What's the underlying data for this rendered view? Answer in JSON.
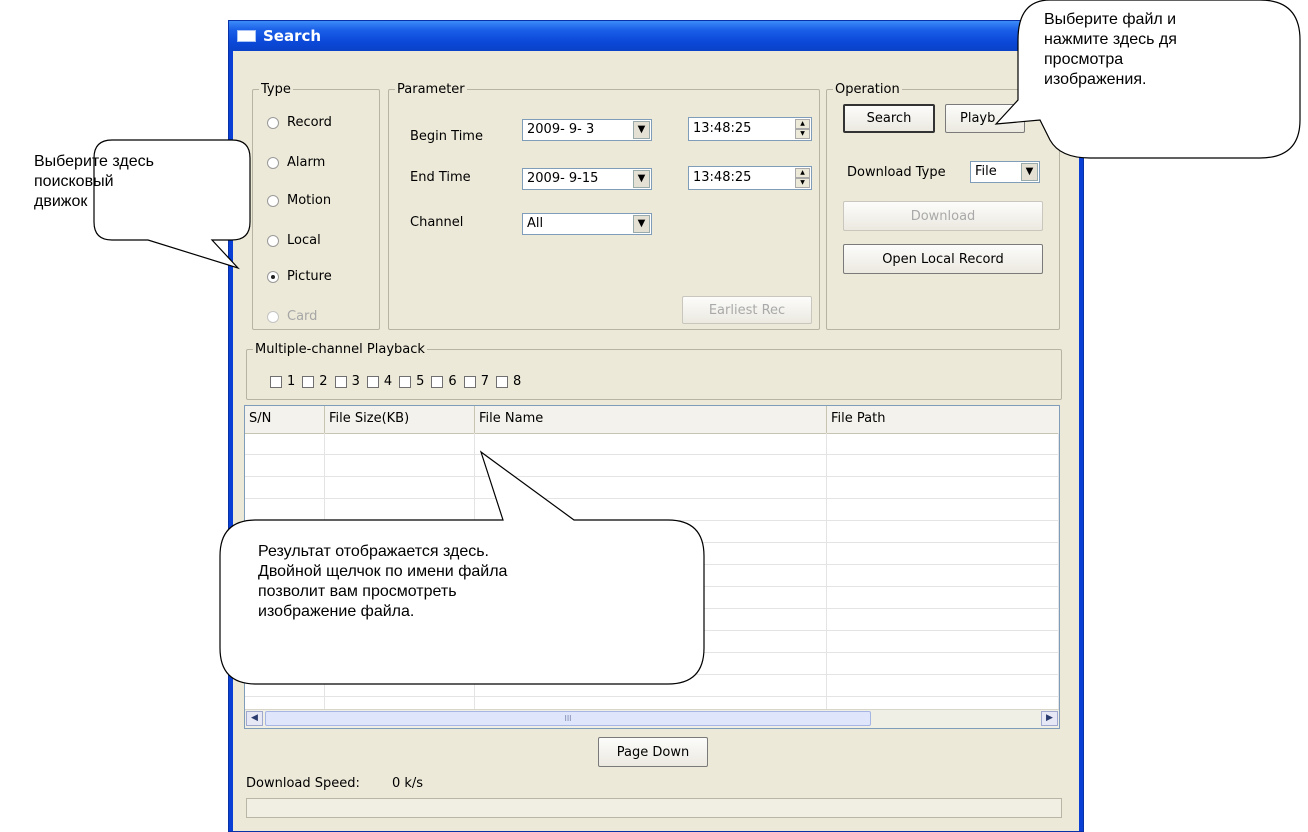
{
  "window": {
    "title": "Search",
    "icon": "window-icon"
  },
  "type_group": {
    "legend": "Type",
    "options": [
      {
        "label": "Record",
        "checked": false,
        "disabled": false
      },
      {
        "label": "Alarm",
        "checked": false,
        "disabled": false
      },
      {
        "label": "Motion",
        "checked": false,
        "disabled": false
      },
      {
        "label": "Local",
        "checked": false,
        "disabled": false
      },
      {
        "label": "Picture",
        "checked": true,
        "disabled": false
      },
      {
        "label": "Card",
        "checked": false,
        "disabled": true
      }
    ]
  },
  "parameter": {
    "legend": "Parameter",
    "begin_label": "Begin Time",
    "begin_date": "2009- 9- 3",
    "begin_time": "13:48:25",
    "end_label": "End Time",
    "end_date": "2009- 9-15",
    "end_time": "13:48:25",
    "channel_label": "Channel",
    "channel_value": "All",
    "earliest_button": "Earliest Rec"
  },
  "operation": {
    "legend": "Operation",
    "search_button": "Search",
    "playback_button": "Playb",
    "download_type_label": "Download Type",
    "download_type_value": "File",
    "download_button": "Download",
    "open_local_button": "Open Local Record"
  },
  "multichannel": {
    "legend": "Multiple-channel Playback",
    "channels": [
      "1",
      "2",
      "3",
      "4",
      "5",
      "6",
      "7",
      "8"
    ]
  },
  "table": {
    "columns": [
      "S/N",
      "File Size(KB)",
      "File Name",
      "File Path"
    ],
    "scroll_grip": "III"
  },
  "footer": {
    "page_down_button": "Page Down",
    "download_speed_label": "Download Speed:",
    "download_speed_value": "0 k/s"
  },
  "callouts": {
    "type_hint": "Выберите здесь\nпоисковый\nдвижок",
    "operation_hint": "Выберите файл и\nнажмите здесь дя\nпросмотра\nизображения.",
    "result_hint": "Результат отображается здесь.\nДвойной щелчок по имени файла\nпозволит вам просмотреть\nизображение файла."
  }
}
